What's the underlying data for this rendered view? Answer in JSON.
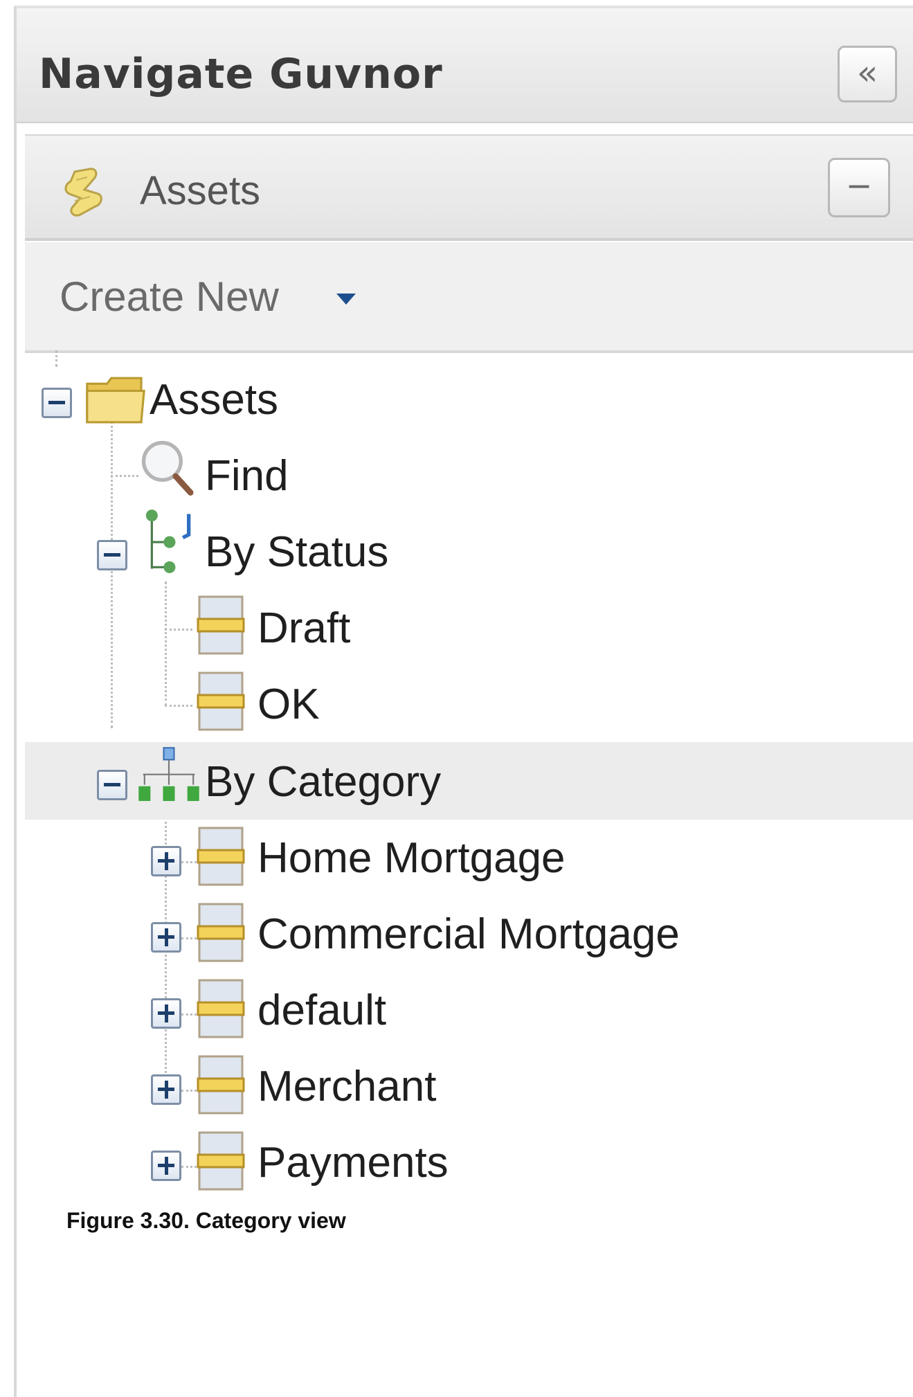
{
  "panel": {
    "title": "Navigate Guvnor",
    "collapse_glyph": "«"
  },
  "section": {
    "title": "Assets",
    "icon": "assets-scroll-icon",
    "collapse_glyph": "−"
  },
  "toolbar": {
    "create_new_label": "Create New"
  },
  "tree": {
    "root": {
      "label": "Assets",
      "expanded": true
    },
    "find": {
      "label": "Find"
    },
    "by_status": {
      "label": "By Status",
      "expanded": true,
      "items": [
        {
          "label": "Draft"
        },
        {
          "label": "OK"
        }
      ]
    },
    "by_category": {
      "label": "By Category",
      "expanded": true,
      "selected": true,
      "items": [
        {
          "label": "Home Mortgage",
          "expanded": false
        },
        {
          "label": "Commercial Mortgage",
          "expanded": false
        },
        {
          "label": "default",
          "expanded": false
        },
        {
          "label": "Merchant",
          "expanded": false
        },
        {
          "label": "Payments",
          "expanded": false
        }
      ]
    }
  },
  "caption": "Figure 3.30. Category view",
  "colors": {
    "selected_row": "#ececec",
    "toggle_border": "#7d8ea6",
    "folder": "#f3d66b",
    "status_icon": "#5aa55a",
    "category_icon": "#3a9b3a",
    "caret": "#1d4f8e"
  }
}
